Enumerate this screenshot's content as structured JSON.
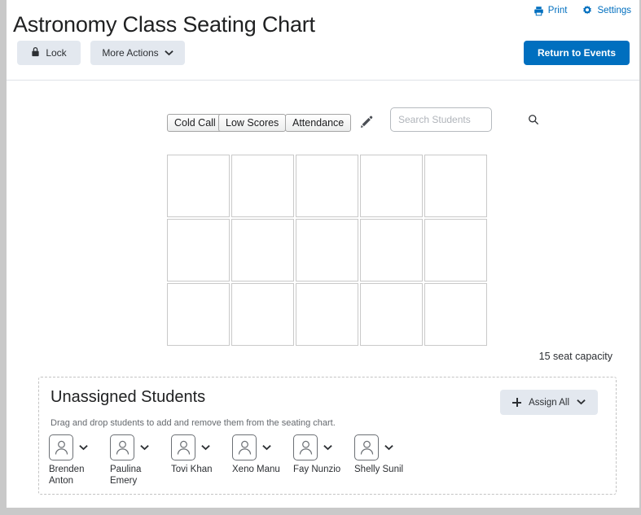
{
  "header": {
    "title": "Astronomy Class Seating Chart",
    "links": [
      {
        "label": "Print",
        "icon": "printer-icon"
      },
      {
        "label": "Settings",
        "icon": "gear-icon"
      }
    ],
    "accent_color": "#006fbf"
  },
  "toolbar": {
    "lock_label": "Lock",
    "lock_icon": "lock-icon",
    "more_actions_label": "More Actions",
    "return_label": "Return to Events"
  },
  "controls": {
    "chips": [
      {
        "label": "Cold Call"
      },
      {
        "label": "Low Scores"
      },
      {
        "label": "Attendance"
      }
    ],
    "edit_icon": "pencil-icon",
    "search": {
      "placeholder": "Search Students",
      "value": "",
      "icon": "search-icon"
    }
  },
  "chart": {
    "rows": 3,
    "columns": 5,
    "seats": [
      {
        "id": "seat-1",
        "occupant": ""
      },
      {
        "id": "seat-2",
        "occupant": ""
      },
      {
        "id": "seat-3",
        "occupant": ""
      },
      {
        "id": "seat-4",
        "occupant": ""
      },
      {
        "id": "seat-5",
        "occupant": ""
      },
      {
        "id": "seat-6",
        "occupant": ""
      },
      {
        "id": "seat-7",
        "occupant": ""
      },
      {
        "id": "seat-8",
        "occupant": ""
      },
      {
        "id": "seat-9",
        "occupant": ""
      },
      {
        "id": "seat-10",
        "occupant": ""
      },
      {
        "id": "seat-11",
        "occupant": ""
      },
      {
        "id": "seat-12",
        "occupant": ""
      },
      {
        "id": "seat-13",
        "occupant": ""
      },
      {
        "id": "seat-14",
        "occupant": ""
      },
      {
        "id": "seat-15",
        "occupant": ""
      }
    ],
    "capacity_label": "15 seat capacity"
  },
  "unassigned": {
    "title": "Unassigned Students",
    "subtitle": "Drag and drop students to add and remove them from the seating chart.",
    "assign_all_label": "Assign All",
    "students": [
      {
        "name": "Brenden Anton"
      },
      {
        "name": "Paulina Emery"
      },
      {
        "name": "Tovi Khan"
      },
      {
        "name": "Xeno Manu"
      },
      {
        "name": "Fay Nunzio"
      },
      {
        "name": "Shelly Sunil"
      }
    ]
  }
}
